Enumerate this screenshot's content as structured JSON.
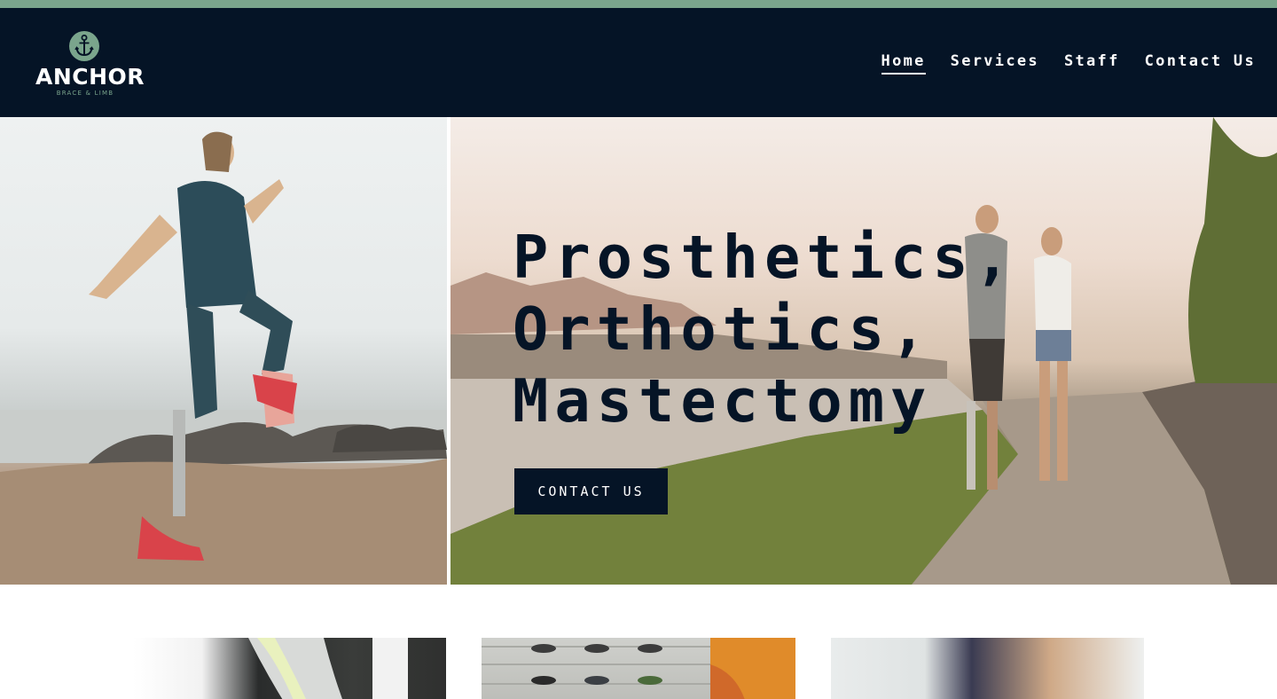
{
  "brand": {
    "name": "ANCHOR",
    "tagline": "BRACE & LIMB",
    "colors": {
      "navy": "#051426",
      "sage": "#7aa58c",
      "white": "#ffffff"
    }
  },
  "nav": {
    "items": [
      {
        "label": "Home",
        "active": true
      },
      {
        "label": "Services",
        "active": false
      },
      {
        "label": "Staff",
        "active": false
      },
      {
        "label": "Contact Us",
        "active": false
      }
    ]
  },
  "hero": {
    "title_lines": [
      "Prosthetics,",
      "Orthotics,",
      "Mastectomy"
    ],
    "cta_label": "CONTACT US",
    "left_image": "photo-woman-prosthetic-leg-exercising-on-beach",
    "right_image": "photo-couple-walking-riverside-prosthetic-leg"
  },
  "cards": [
    {
      "image": "photo-orthotic-brace"
    },
    {
      "image": "photo-shoe-wall-display"
    },
    {
      "image": "photo-woman-with-child"
    }
  ]
}
